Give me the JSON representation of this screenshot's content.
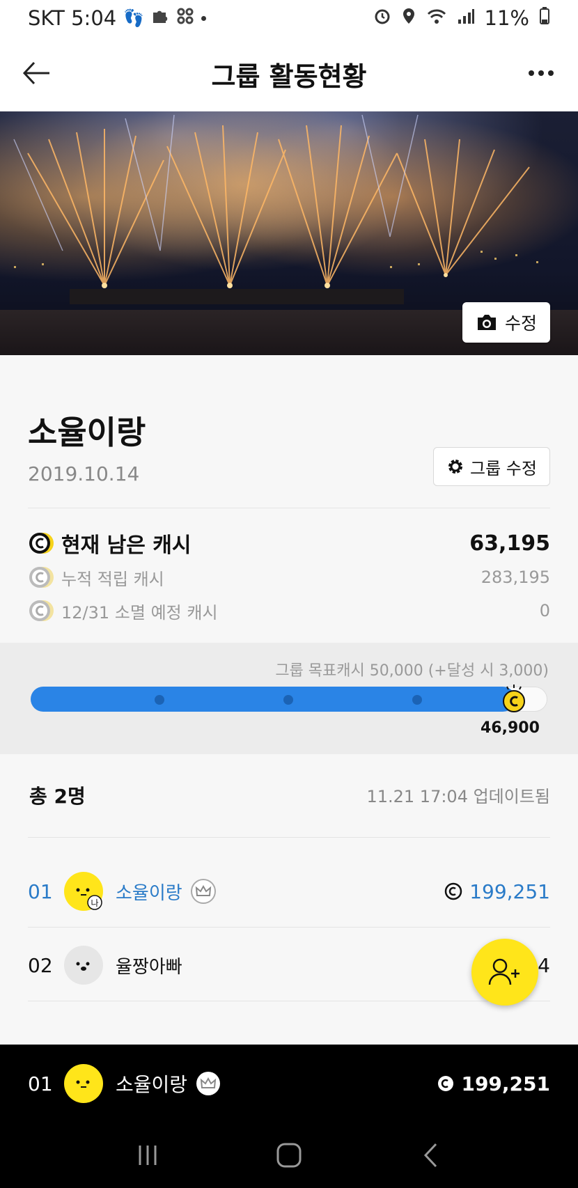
{
  "status_bar": {
    "carrier_time": "SKT 5:04",
    "battery": "11%",
    "icons": [
      "footprints-icon",
      "puzzle-icon",
      "grid-icon",
      "dot-icon",
      "alarm-icon",
      "location-icon",
      "wifi-icon",
      "signal-icon",
      "battery-icon"
    ]
  },
  "header": {
    "title": "그룹 활동현황",
    "back_icon": "arrow-left-icon",
    "more_icon": "more-horizontal-icon"
  },
  "banner": {
    "edit_label": "수정",
    "edit_icon": "camera-icon"
  },
  "group": {
    "name": "소율이랑",
    "created_date": "2019.10.14",
    "edit_button_label": "그룹 수정",
    "edit_icon": "gear-icon"
  },
  "cash": {
    "current_label": "현재 남은 캐시",
    "current_value": "63,195",
    "accumulated_label": "누적 적립 캐시",
    "accumulated_value": "283,195",
    "expiring_label": "12/31 소멸 예정 캐시",
    "expiring_value": "0"
  },
  "goal": {
    "text": "그룹 목표캐시 50,000 (+달성 시 3,000)",
    "current_value_label": "46,900",
    "current": 46900,
    "target": 50000
  },
  "members": {
    "count_label": "총 2명",
    "updated_label": "11.21 17:04 업데이트됨",
    "list": [
      {
        "rank": "01",
        "name": "소율이랑",
        "cash": "199,251",
        "is_me_badge": "나"
      },
      {
        "rank": "02",
        "name": "율짱아빠",
        "cash": "4"
      }
    ]
  },
  "my_rank_bar": {
    "rank": "01",
    "name": "소율이랑",
    "cash": "199,251"
  },
  "colors": {
    "accent_blue": "#2a84e6",
    "rank_blue": "#2a7bc8",
    "brand_yellow": "#ffe51a",
    "coin_yellow": "#f6d31a"
  },
  "fab": {
    "icon": "add-person-icon"
  },
  "nav": {
    "icons": [
      "recent-apps-icon",
      "home-icon",
      "back-icon"
    ]
  }
}
